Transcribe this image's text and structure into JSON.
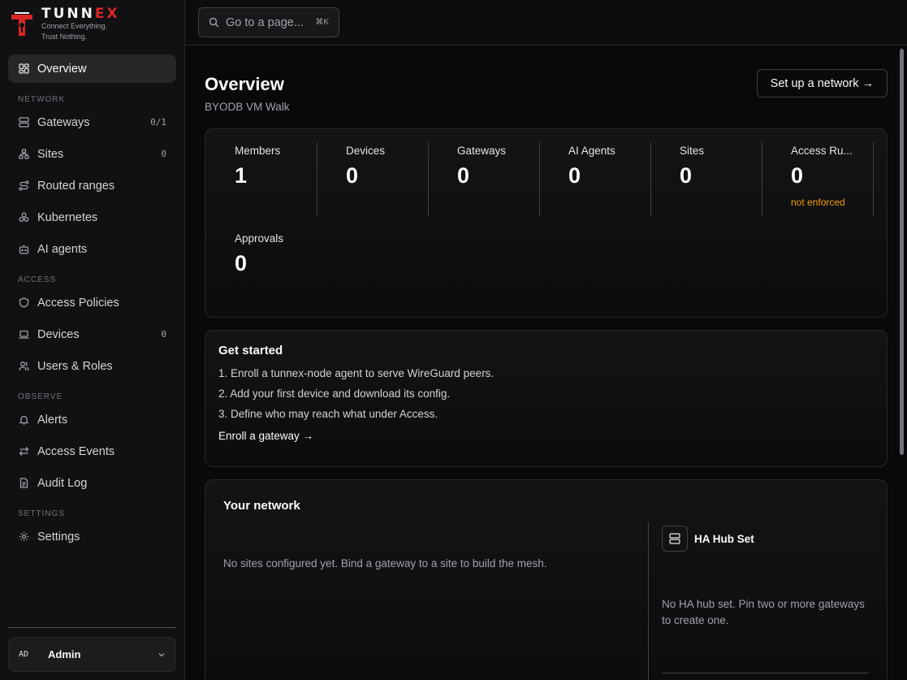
{
  "brand": {
    "name_main": "TUNN",
    "name_accent": "EX",
    "tagline_1": "Connect Everything.",
    "tagline_2": "Trust Nothing.",
    "accent_color": "#dc2626"
  },
  "search": {
    "placeholder": "Go to a page...",
    "shortcut": "⌘K"
  },
  "sidebar": {
    "overview": {
      "label": "Overview",
      "icon": "grid-icon"
    },
    "sections": {
      "network": "NETWORK",
      "access": "ACCESS",
      "observe": "OBSERVE",
      "settings": "SETTINGS"
    },
    "items": {
      "gateways": {
        "label": "Gateways",
        "count": "0/1",
        "icon": "server-icon"
      },
      "sites": {
        "label": "Sites",
        "count": "0",
        "icon": "sitemap-icon"
      },
      "routed_ranges": {
        "label": "Routed ranges",
        "icon": "route-icon"
      },
      "kubernetes": {
        "label": "Kubernetes",
        "icon": "boxes-icon"
      },
      "ai_agents": {
        "label": "AI agents",
        "icon": "bot-icon"
      },
      "access_policies": {
        "label": "Access Policies",
        "icon": "shield-icon"
      },
      "devices": {
        "label": "Devices",
        "count": "0",
        "icon": "laptop-icon"
      },
      "users_roles": {
        "label": "Users & Roles",
        "icon": "users-icon"
      },
      "alerts": {
        "label": "Alerts",
        "icon": "bell-icon"
      },
      "access_events": {
        "label": "Access Events",
        "icon": "arrows-icon"
      },
      "audit_log": {
        "label": "Audit Log",
        "icon": "file-icon"
      },
      "settings": {
        "label": "Settings",
        "icon": "gear-icon"
      }
    }
  },
  "user": {
    "initials": "AD",
    "name": "Admin"
  },
  "page": {
    "title": "Overview",
    "subtitle": "BYODB VM Walk",
    "setup_button": "Set up a network →"
  },
  "stats": [
    {
      "label": "Members",
      "value": "1"
    },
    {
      "label": "Devices",
      "value": "0"
    },
    {
      "label": "Gateways",
      "value": "0"
    },
    {
      "label": "AI Agents",
      "value": "0"
    },
    {
      "label": "Sites",
      "value": "0"
    },
    {
      "label": "Access Ru...",
      "value": "0",
      "note": "not enforced"
    },
    {
      "label": "Approvals",
      "value": "0"
    }
  ],
  "get_started": {
    "title": "Get started",
    "steps": [
      "1. Enroll a tunnex-node agent to serve WireGuard peers.",
      "2. Add your first device and download its config.",
      "3. Define who may reach what under Access."
    ],
    "link": "Enroll a gateway →"
  },
  "network": {
    "title": "Your network",
    "empty": "No sites configured yet. Bind a gateway to a site to build the mesh.",
    "ha_title": "HA Hub Set",
    "ha_empty": "No HA hub set. Pin two or more gateways to create one."
  }
}
